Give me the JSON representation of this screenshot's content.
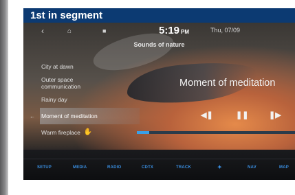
{
  "banner": {
    "text": "1st in segment"
  },
  "status": {
    "back_icon": "chevron-left",
    "home_icon": "home",
    "menu_icon": "menu",
    "time": "5:19",
    "ampm": "PM",
    "date": "Thu, 07/09"
  },
  "category": "Sounds of nature",
  "playlist": [
    {
      "label": "City at dawn",
      "selected": false
    },
    {
      "label": "Outer space communication",
      "selected": false
    },
    {
      "label": "Rainy day",
      "selected": false
    },
    {
      "label": "Moment of meditation",
      "selected": true
    },
    {
      "label": "Warm fireplace",
      "selected": false
    }
  ],
  "now_playing": {
    "title": "Moment of meditation",
    "progress": 0.08
  },
  "controls": {
    "prev_icon": "skip-previous",
    "pause_icon": "pause",
    "next_icon": "skip-next"
  },
  "dock": {
    "setup": "SETUP",
    "media": "MEDIA",
    "radio": "RADIO",
    "cdtx": "CDTX",
    "track": "TRACK",
    "star_icon": "star",
    "nav": "NAV",
    "map": "MAP"
  },
  "colors": {
    "banner": "#0c3a72",
    "accent": "#3a8ee0"
  }
}
